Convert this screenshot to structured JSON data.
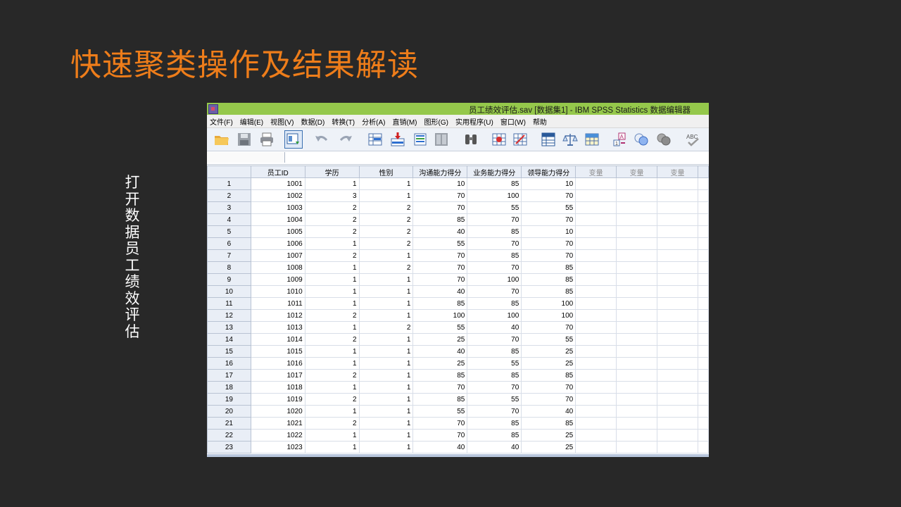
{
  "slide": {
    "title": "快速聚类操作及结果解读",
    "caption": "打开数据员工绩效评估"
  },
  "window": {
    "title": "员工绩效评估.sav [数据集1] - IBM SPSS Statistics 数据编辑器",
    "titlebar_color": "#95c84b"
  },
  "menu": [
    {
      "label": "文件(F)"
    },
    {
      "label": "编辑(E)"
    },
    {
      "label": "视图(V)"
    },
    {
      "label": "数据(D)"
    },
    {
      "label": "转换(T)"
    },
    {
      "label": "分析(A)"
    },
    {
      "label": "直销(M)"
    },
    {
      "label": "图形(G)"
    },
    {
      "label": "实用程序(U)"
    },
    {
      "label": "窗口(W)"
    },
    {
      "label": "帮助"
    }
  ],
  "toolbar_icons": [
    "open-folder-icon",
    "save-icon",
    "print-icon",
    "dialog-recall-icon",
    "undo-icon",
    "redo-icon",
    "goto-case-icon",
    "goto-variable-icon",
    "variables-icon",
    "split-pane-icon",
    "find-icon",
    "insert-cases-icon",
    "insert-variable-icon",
    "split-file-icon",
    "weight-cases-icon",
    "select-cases-icon",
    "value-labels-icon",
    "use-sets-icon",
    "show-sets-icon",
    "spell-check-icon"
  ],
  "grid": {
    "columns": [
      "员工ID",
      "学历",
      "性别",
      "沟通能力得分",
      "业务能力得分",
      "领导能力得分",
      "变量",
      "变量",
      "变量"
    ],
    "rows": [
      [
        "1",
        "1001",
        "1",
        "1",
        "10",
        "85",
        "10"
      ],
      [
        "2",
        "1002",
        "3",
        "1",
        "70",
        "100",
        "70"
      ],
      [
        "3",
        "1003",
        "2",
        "2",
        "70",
        "55",
        "55"
      ],
      [
        "4",
        "1004",
        "2",
        "2",
        "85",
        "70",
        "70"
      ],
      [
        "5",
        "1005",
        "2",
        "2",
        "40",
        "85",
        "10"
      ],
      [
        "6",
        "1006",
        "1",
        "2",
        "55",
        "70",
        "70"
      ],
      [
        "7",
        "1007",
        "2",
        "1",
        "70",
        "85",
        "70"
      ],
      [
        "8",
        "1008",
        "1",
        "2",
        "70",
        "70",
        "85"
      ],
      [
        "9",
        "1009",
        "1",
        "1",
        "70",
        "100",
        "85"
      ],
      [
        "10",
        "1010",
        "1",
        "1",
        "40",
        "70",
        "85"
      ],
      [
        "11",
        "1011",
        "1",
        "1",
        "85",
        "85",
        "100"
      ],
      [
        "12",
        "1012",
        "2",
        "1",
        "100",
        "100",
        "100"
      ],
      [
        "13",
        "1013",
        "1",
        "2",
        "55",
        "40",
        "70"
      ],
      [
        "14",
        "1014",
        "2",
        "1",
        "25",
        "70",
        "55"
      ],
      [
        "15",
        "1015",
        "1",
        "1",
        "40",
        "85",
        "25"
      ],
      [
        "16",
        "1016",
        "1",
        "1",
        "25",
        "55",
        "25"
      ],
      [
        "17",
        "1017",
        "2",
        "1",
        "85",
        "85",
        "85"
      ],
      [
        "18",
        "1018",
        "1",
        "1",
        "70",
        "70",
        "70"
      ],
      [
        "19",
        "1019",
        "2",
        "1",
        "85",
        "55",
        "70"
      ],
      [
        "20",
        "1020",
        "1",
        "1",
        "55",
        "70",
        "40"
      ],
      [
        "21",
        "1021",
        "2",
        "1",
        "70",
        "85",
        "85"
      ],
      [
        "22",
        "1022",
        "1",
        "1",
        "70",
        "85",
        "25"
      ],
      [
        "23",
        "1023",
        "1",
        "1",
        "40",
        "40",
        "25"
      ]
    ]
  }
}
